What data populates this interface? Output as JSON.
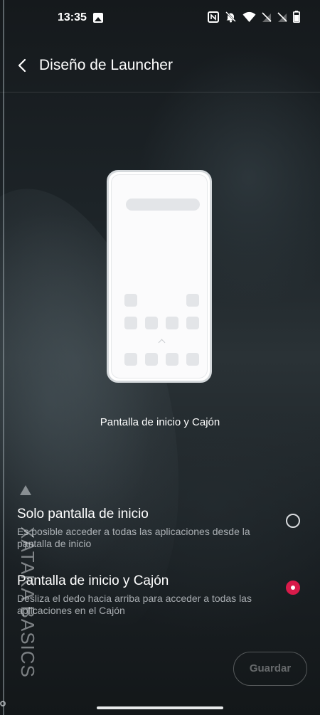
{
  "status_bar": {
    "time": "13:35",
    "icons": [
      "image-icon",
      "nfc-icon",
      "mute-icon",
      "wifi-icon",
      "no-signal-icon",
      "no-signal-icon",
      "battery-icon"
    ]
  },
  "app_bar": {
    "title": "Diseño de Launcher"
  },
  "illustration": {
    "caption": "Pantalla de inicio y Cajón"
  },
  "options": [
    {
      "title": "Solo pantalla de inicio",
      "description": "Es posible acceder a todas las aplicaciones desde la pantalla de inicio",
      "selected": false
    },
    {
      "title": "Pantalla de inicio y Cajón",
      "description": "Desliza el dedo hacia arriba para acceder a todas las aplicaciones en el Cajón",
      "selected": true
    }
  ],
  "save_button": {
    "label": "Guardar",
    "enabled": false
  },
  "watermark": {
    "text": "XATAKA BASICS"
  },
  "colors": {
    "accent": "#d81b4a"
  }
}
